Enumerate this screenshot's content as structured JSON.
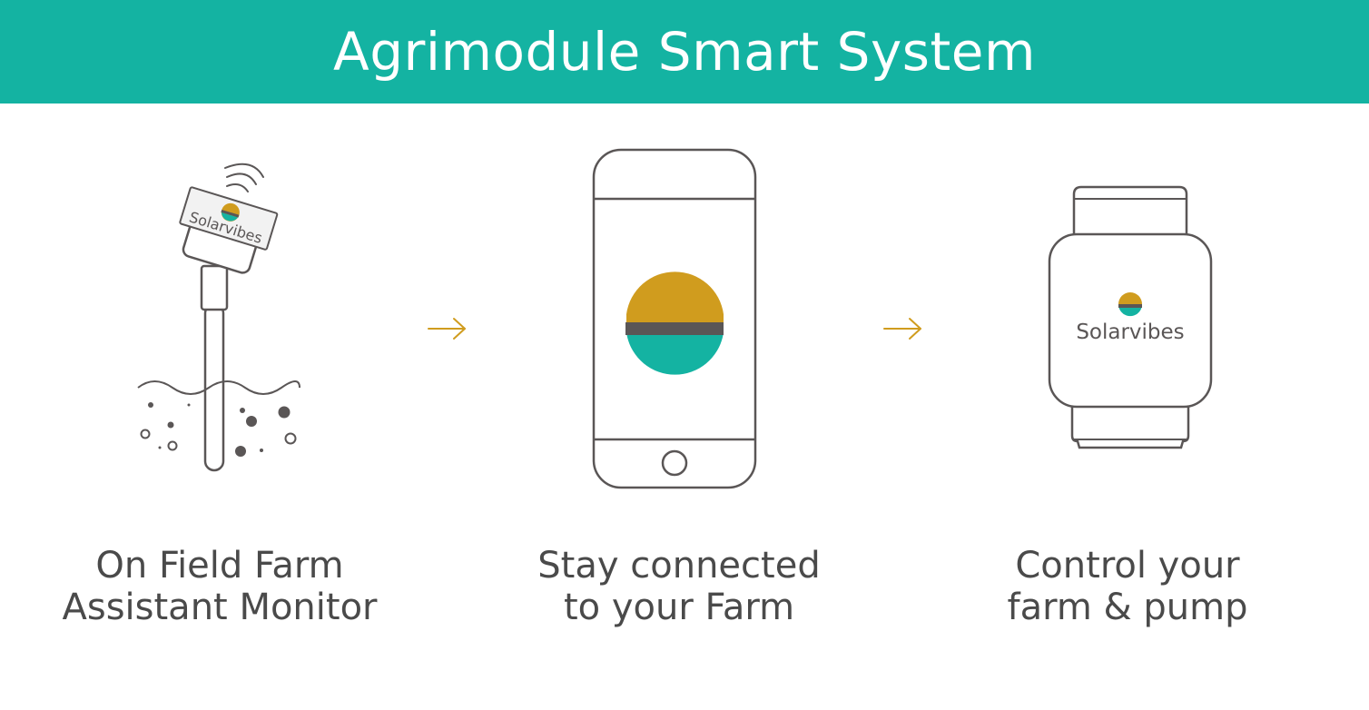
{
  "header": {
    "title": "Agrimodule Smart System"
  },
  "brand": {
    "name": "Solarvibes",
    "colors": {
      "gold": "#d09c1e",
      "teal": "#14b3a2",
      "dark": "#5a5656"
    }
  },
  "steps": [
    {
      "icon": "soil-sensor-icon",
      "line1": "On Field Farm",
      "line2": "Assistant Monitor"
    },
    {
      "icon": "smartphone-icon",
      "line1": "Stay connected",
      "line2": "to your Farm"
    },
    {
      "icon": "smartwatch-icon",
      "line1": "Control your",
      "line2": "farm & pump"
    }
  ],
  "arrows": [
    {
      "icon": "arrow-right-icon"
    },
    {
      "icon": "arrow-right-icon"
    }
  ]
}
